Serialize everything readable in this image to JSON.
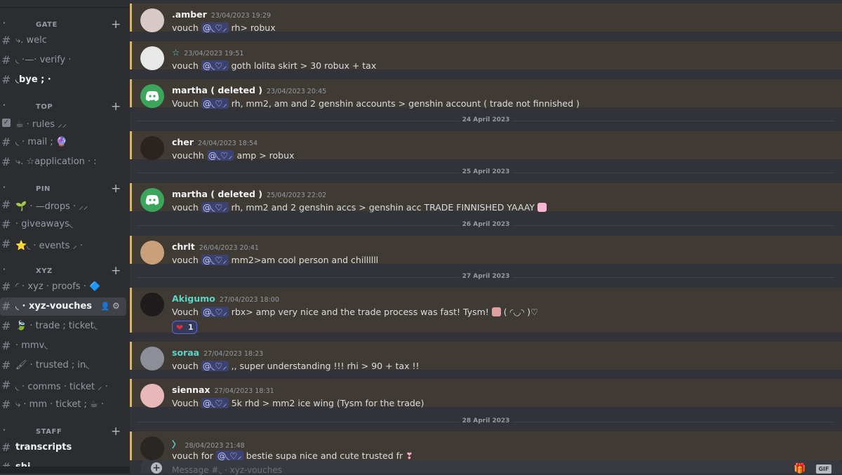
{
  "sidebar": {
    "categories": [
      {
        "name": "GATE",
        "dot": "·"
      },
      {
        "name": "TOP",
        "dot": "·"
      },
      {
        "name": "PIN",
        "dot": "·"
      },
      {
        "name": "XYZ",
        "dot": "·"
      },
      {
        "name": "STAFF",
        "dot": "·"
      }
    ],
    "channels": [
      {
        "label": "⤷. welc"
      },
      {
        "label": "◟ ·—· verify ·"
      },
      {
        "label": "◟bye ; ·"
      },
      {
        "label": "☕ · rules ⸝⸝"
      },
      {
        "label": "◟ · mail ; 🔮"
      },
      {
        "label": "⤷. ☆application · :"
      },
      {
        "label": "🌱 · —drops · ⸝⸝"
      },
      {
        "label": "· giveaways◟"
      },
      {
        "label": "⭐◟ · events ⸝ ·"
      },
      {
        "label": "◜ · xyz · proofs · 🔷"
      },
      {
        "label": "◟ · xyz-vouches"
      },
      {
        "label": "🍃 · trade ; ticket◟"
      },
      {
        "label": "· mmv◟"
      },
      {
        "label": "🖌 · trusted ; in◟"
      },
      {
        "label": "◟ · comms · ticket ⸝ ·"
      },
      {
        "label": "⤷ · mm · ticket ; ☕ ·"
      },
      {
        "label": "transcripts"
      },
      {
        "label": "shi"
      }
    ]
  },
  "messages": [
    {
      "author": ".amber",
      "time": "23/04/2023 19:29",
      "pre": "vouch",
      "mention": "@◟♡⸝",
      "post": "rh> robux"
    },
    {
      "author": "☆",
      "time": "23/04/2023 19:51",
      "pre": "vouch",
      "mention": "@◟♡⸝",
      "post": "goth lolita skirt > 30 robux + tax"
    },
    {
      "author": "martha ( deleted )",
      "time": "23/04/2023 20:45",
      "pre": "Vouch",
      "mention": "@◟♡⸝",
      "post": "rh, mm2, am and 2 genshin accounts > genshin account ( trade not finnished )"
    },
    {
      "author": "cher",
      "time": "24/04/2023 18:54",
      "pre": "vouchh",
      "mention": "@◟♡⸝",
      "post": "amp > robux"
    },
    {
      "author": "martha ( deleted )",
      "time": "25/04/2023 22:02",
      "pre": "vouch",
      "mention": "@◟♡⸝",
      "post": "rh, mm2 and 2 genshin accs > genshin acc TRADE FINNISHED YAAAY"
    },
    {
      "author": "chrlt",
      "time": "26/04/2023 20:41",
      "pre": "vouch",
      "mention": "@◟♡⸝",
      "post": "mm2>am cool person and chillllll"
    },
    {
      "author": "Akigumo",
      "time": "27/04/2023 18:00",
      "pre": "Vouch",
      "mention": "@◟♡⸝",
      "post": " rbx> amp very nice and the trade process was fast! Tysm! ",
      "post2": "( ◜◡◝ )♡",
      "reaction_count": "1"
    },
    {
      "author": "soraa",
      "time": "27/04/2023 18:23",
      "pre": "vouch",
      "mention": "@◟♡⸝",
      "post": ",, super understanding  !!! rhi > 90 + tax !!"
    },
    {
      "author": "siennax",
      "time": "27/04/2023 18:31",
      "pre": "Vouch",
      "mention": "@◟♡⸝",
      "post": "5k rhd > mm2 ice wing (Tysm for the trade)"
    },
    {
      "author": "〉",
      "time": "28/04/2023 21:48",
      "pre": "vouch for",
      "mention": "@◟♡⸝",
      "post": "bestie supa nice and cute trusted fr"
    }
  ],
  "dividers": [
    "24 April 2023",
    "25 April 2023",
    "26 April 2023",
    "27 April 2023",
    "28 April 2023"
  ],
  "composer": {
    "placeholder": "Message #◟ · xyz-vouches"
  },
  "colors": {
    "highlight_bg": "#3f3a33",
    "highlight_border": "#f0b232",
    "mention_bg": "#3c4270"
  },
  "icons": {
    "plus": "+",
    "hash": "#",
    "heart": "❤",
    "gift": "🎁",
    "gif": "GIF"
  }
}
